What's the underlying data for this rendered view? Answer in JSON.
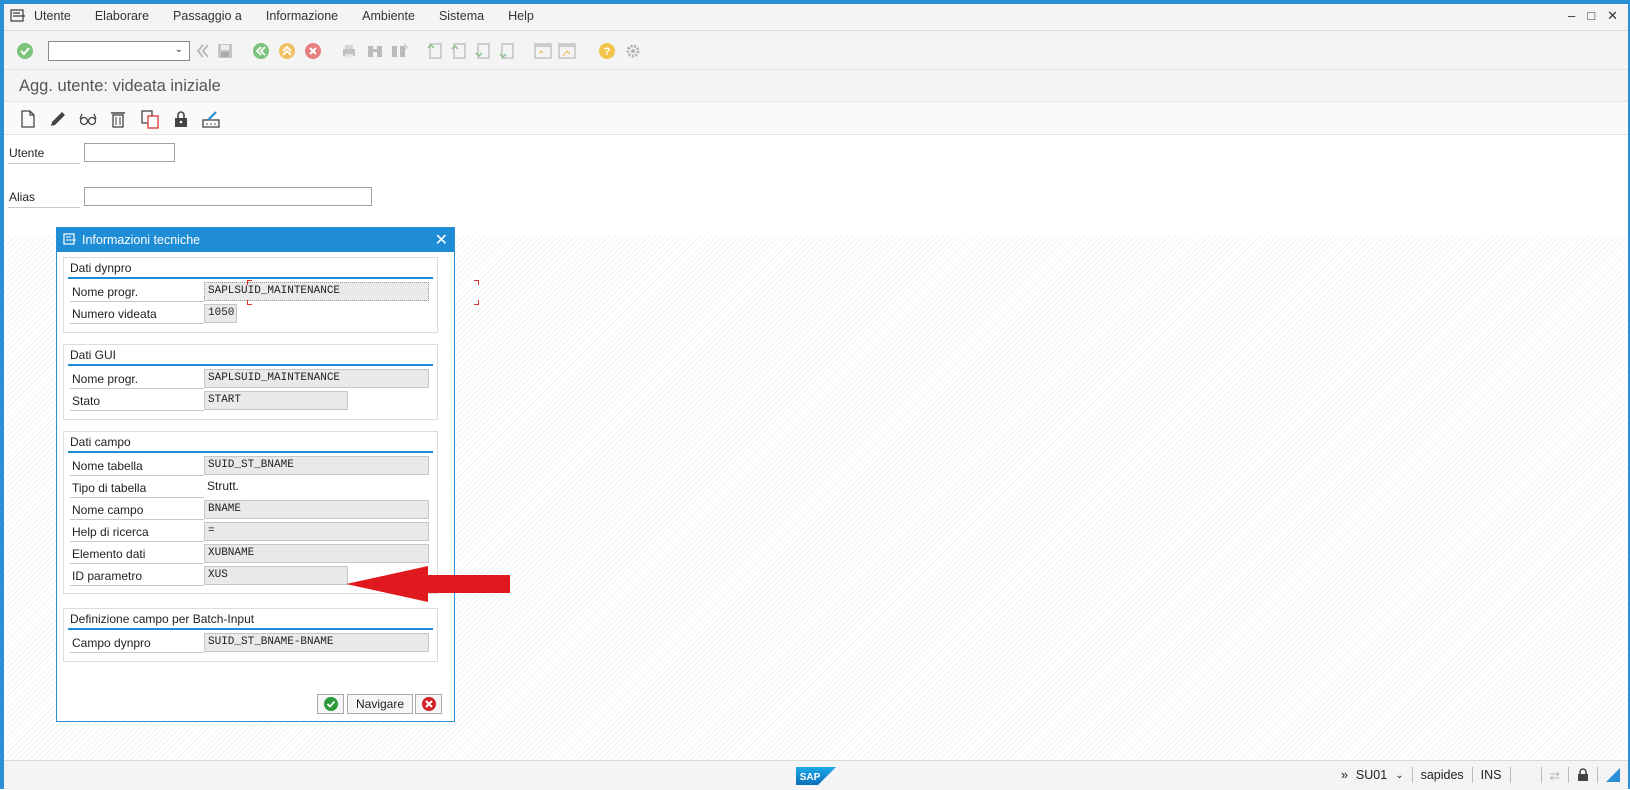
{
  "menubar": {
    "items": [
      "Utente",
      "Elaborare",
      "Passaggio a",
      "Informazione",
      "Ambiente",
      "Sistema",
      "Help"
    ],
    "window_controls": [
      "minimize-icon",
      "maximize-icon",
      "close-icon"
    ]
  },
  "toolbar": {
    "command_field_value": "",
    "icons": [
      "enter-icon",
      "back-arrows-icon",
      "save-icon",
      "back-icon",
      "exit-icon",
      "cancel-icon",
      "print-icon",
      "find-icon",
      "find-next-icon",
      "first-page-icon",
      "previous-page-icon",
      "next-page-icon",
      "last-page-icon",
      "new-session-icon",
      "shortcut-icon",
      "help-icon",
      "settings-icon"
    ]
  },
  "title": "Agg. utente: videata iniziale",
  "app_toolbar": {
    "icons": [
      "create-icon",
      "change-icon",
      "display-icon",
      "delete-icon",
      "copy-icon",
      "lock-icon",
      "change-password-icon"
    ]
  },
  "form": {
    "user_label": "Utente",
    "user_value": "",
    "alias_label": "Alias",
    "alias_value": ""
  },
  "dialog": {
    "title": "Informazioni tecniche",
    "groups": {
      "dynpro": {
        "title": "Dati dynpro",
        "program_label": "Nome progr.",
        "program_value": "SAPLSUID_MAINTENANCE",
        "screen_label": "Numero videata",
        "screen_value": "1050"
      },
      "gui": {
        "title": "Dati GUI",
        "program_label": "Nome progr.",
        "program_value": "SAPLSUID_MAINTENANCE",
        "status_label": "Stato",
        "status_value": "START"
      },
      "field": {
        "title": "Dati campo",
        "table_label": "Nome tabella",
        "table_value": "SUID_ST_BNAME",
        "table_type_label": "Tipo di tabella",
        "table_type_value": "Strutt.",
        "field_label": "Nome campo",
        "field_value": "BNAME",
        "search_help_label": "Help di ricerca",
        "search_help_value": "=",
        "data_element_label": "Elemento dati",
        "data_element_value": "XUBNAME",
        "param_id_label": "ID parametro",
        "param_id_value": "XUS"
      },
      "batch": {
        "title": "Definizione campo per Batch-Input",
        "dynpro_field_label": "Campo dynpro",
        "dynpro_field_value": "SUID_ST_BNAME-BNAME"
      }
    },
    "buttons": {
      "navigate": "Navigare"
    }
  },
  "statusbar": {
    "logo": "SAP",
    "transaction": "SU01",
    "server": "sapides",
    "mode": "INS"
  },
  "colors": {
    "accent": "#2a8fd4",
    "arrow": "#e0191f"
  }
}
